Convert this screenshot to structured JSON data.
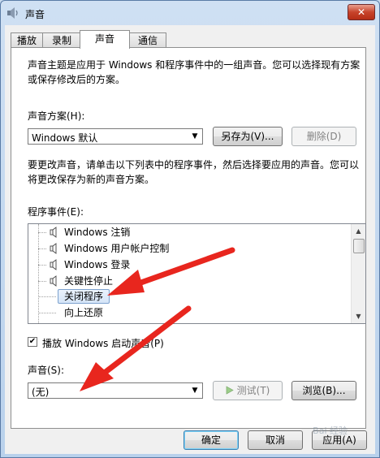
{
  "window": {
    "title": "声音",
    "close_glyph": "✕"
  },
  "tabs": [
    {
      "label": "播放",
      "active": false
    },
    {
      "label": "录制",
      "active": false
    },
    {
      "label": "声音",
      "active": true
    },
    {
      "label": "通信",
      "active": false
    }
  ],
  "intro_text": "声音主题是应用于 Windows 和程序事件中的一组声音。您可以选择现有方案或保存修改后的方案。",
  "scheme": {
    "label": "声音方案(H):",
    "selected": "Windows 默认",
    "save_as_label": "另存为(V)...",
    "delete_label": "删除(D)"
  },
  "change_text": "要更改声音，请单击以下列表中的程序事件，然后选择要应用的声音。您可以将更改保存为新的声音方案。",
  "events": {
    "label": "程序事件(E):",
    "items": [
      {
        "text": "Windows 注销",
        "has_sound": true,
        "selected": false
      },
      {
        "text": "Windows 用户帐户控制",
        "has_sound": true,
        "selected": false
      },
      {
        "text": "Windows 登录",
        "has_sound": true,
        "selected": false
      },
      {
        "text": "关键性停止",
        "has_sound": true,
        "selected": false
      },
      {
        "text": "关闭程序",
        "has_sound": false,
        "selected": true
      },
      {
        "text": "向上还原",
        "has_sound": false,
        "selected": false
      }
    ]
  },
  "startup_sound": {
    "label": "播放 Windows 启动声音(P)",
    "checked": true,
    "check_glyph": "✔"
  },
  "sound": {
    "label": "声音(S):",
    "selected": "(无)",
    "test_label": "测试(T)",
    "browse_label": "浏览(B)..."
  },
  "footer": {
    "ok_label": "确定",
    "cancel_label": "取消",
    "apply_label": "应用(A)"
  },
  "icons": {
    "app": "speaker-icon",
    "close": "close-icon",
    "combo_arrow": "chevron-down-icon",
    "play": "play-icon"
  },
  "colors": {
    "annotation_arrow": "#e8261e",
    "titlebar": "#c9dbef",
    "selection": "#d5e5f8"
  },
  "watermark": "Bai 经验"
}
